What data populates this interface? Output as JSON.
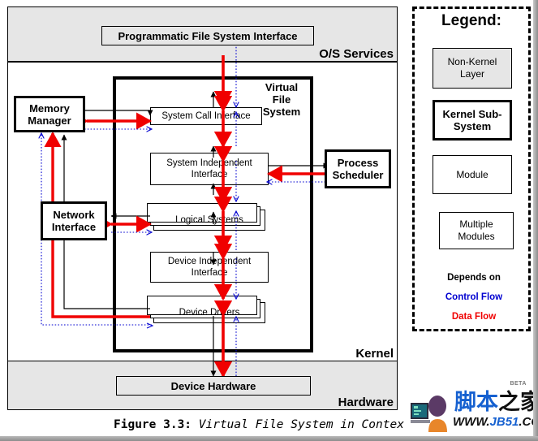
{
  "figure": {
    "number": "Figure 3.3:",
    "title": "Virtual File System in Contex"
  },
  "layers": [
    {
      "name": "os-services",
      "label": "O/S Services",
      "shaded": true
    },
    {
      "name": "kernel",
      "label": "Kernel",
      "shaded": false
    },
    {
      "name": "hardware",
      "label": "Hardware",
      "shaded": true
    }
  ],
  "subsystem": {
    "label": "Virtual\nFile\nSystem",
    "label_line1": "Virtual",
    "label_line2": "File",
    "label_line3": "System"
  },
  "boxes": {
    "programmatic_interface": "Programmatic File System Interface",
    "device_hardware": "Device Hardware",
    "memory_manager": "Memory\nManager",
    "memory_manager_l1": "Memory",
    "memory_manager_l2": "Manager",
    "network_interface_l1": "Network",
    "network_interface_l2": "Interface",
    "process_scheduler_l1": "Process",
    "process_scheduler_l2": "Scheduler",
    "system_call_interface": "System Call Interface",
    "system_independent_l1": "System Independent",
    "system_independent_l2": "Interface",
    "logical_systems": "Logical Systems",
    "device_independent_l1": "Device Independent",
    "device_independent_l2": "Interface",
    "device_drivers": "Device Drivers"
  },
  "legend": {
    "title": "Legend:",
    "non_kernel_l1": "Non-Kernel",
    "non_kernel_l2": "Layer",
    "kernel_sub_l1": "Kernel Sub-",
    "kernel_sub_l2": "System",
    "module": "Module",
    "multiple_l1": "Multiple",
    "multiple_l2": "Modules",
    "depends_on": "Depends on",
    "control_flow": "Control Flow",
    "data_flow": "Data Flow"
  },
  "colors": {
    "depends_on": "#000000",
    "control_flow": "#0000d0",
    "data_flow": "#f00000",
    "shaded_band": "#e6e6e6",
    "outline": "#000000"
  },
  "watermark": {
    "beta": "BETA",
    "brand_blue": "脚本",
    "brand_dark": "之家",
    "url_prefix": "WWW.",
    "url_brand": "JB51",
    "url_suffix": ".CC"
  }
}
